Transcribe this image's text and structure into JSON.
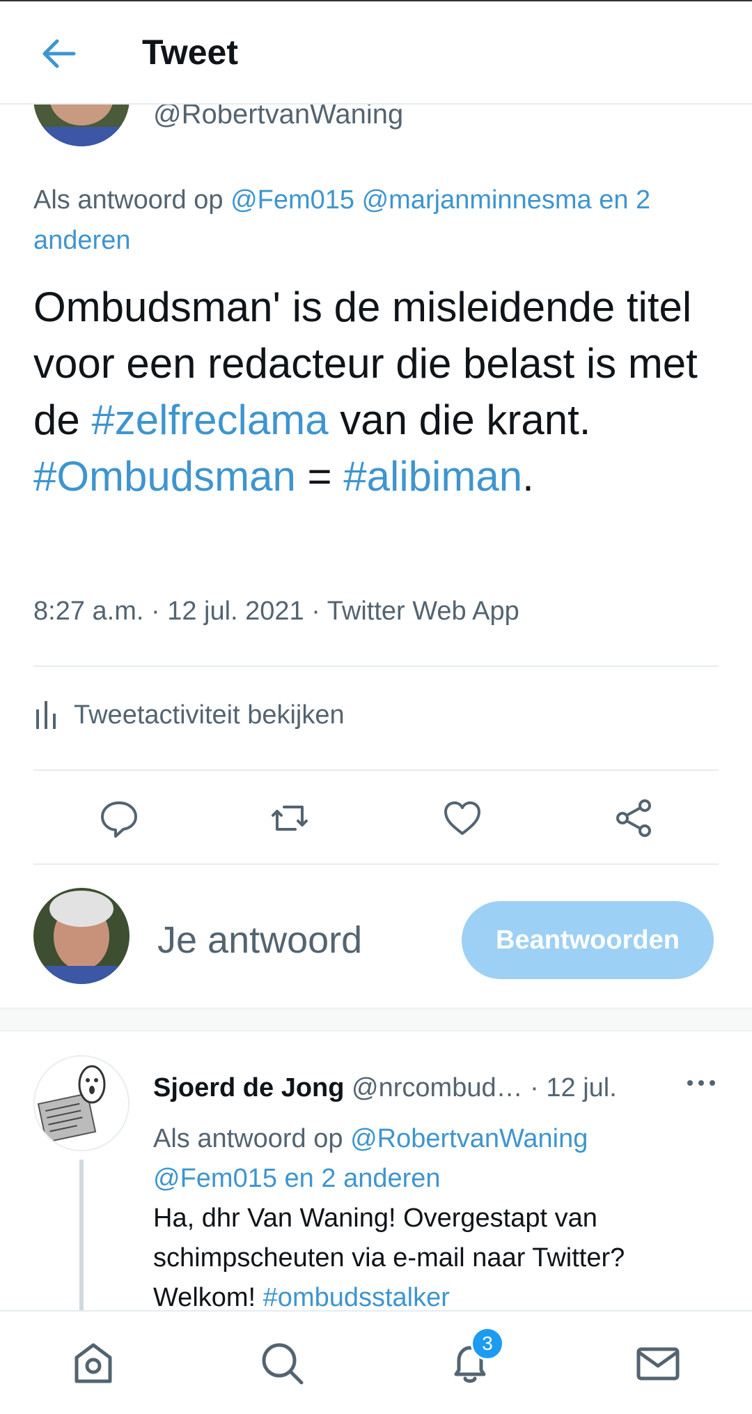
{
  "header": {
    "title": "Tweet"
  },
  "tweet": {
    "handle": "@RobertvanWaning",
    "reply_prefix": "Als antwoord op ",
    "reply_mentions": [
      "@Fem015",
      "@marjanminnesma"
    ],
    "reply_others": " en 2 anderen",
    "body": {
      "t1": "Ombudsman' is de misleidende titel voor een redacteur die belast is met de ",
      "h1": "#zelfreclama",
      "t2": " van die krant.",
      "h2": "#Ombudsman",
      "t3": " = ",
      "h3": "#alibiman",
      "t4": "."
    },
    "meta": "8:27 a.m. · 12 jul. 2021 · Twitter Web App",
    "activity_label": "Tweetactiviteit bekijken"
  },
  "reply_composer": {
    "placeholder": "Je antwoord",
    "button_label": "Beantwoorden"
  },
  "reply": {
    "name": "Sjoerd de Jong",
    "handle": "@nrcombud…",
    "date": "· 12 jul.",
    "reply_prefix": "Als antwoord op ",
    "reply_mention1": "@RobertvanWaning",
    "reply_mention2": "@Fem015",
    "reply_others": " en 2 anderen",
    "body_text": "Ha, dhr Van Waning! Overgestapt van schimpscheuten via e-mail naar Twitter? Welkom! ",
    "body_hashtag": "#ombudsstalker"
  },
  "nav": {
    "notification_count": "3"
  },
  "colors": {
    "accent": "#1d9bf0",
    "button_disabled": "#9dd0f5"
  }
}
